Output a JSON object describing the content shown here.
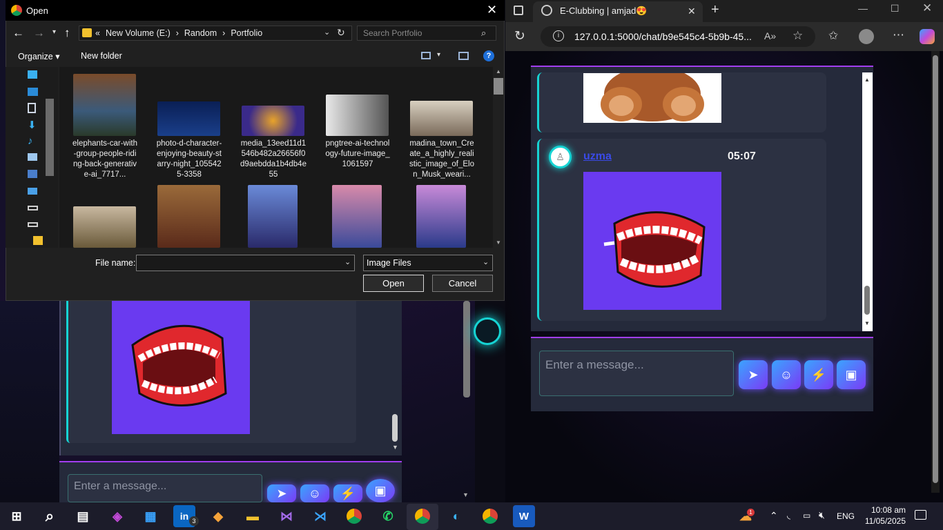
{
  "dialog": {
    "title": "Open",
    "breadcrumb": [
      "«",
      "New Volume (E:)",
      "Random",
      "Portfolio"
    ],
    "search_placeholder": "Search Portfolio",
    "organize_label": "Organize",
    "new_folder_label": "New folder",
    "file_name_label": "File name:",
    "file_name_value": "",
    "file_type": "Image Files",
    "open_label": "Open",
    "cancel_label": "Cancel",
    "files": [
      {
        "name": "elephants-car-with-group-people-riding-back-generative-ai_7717..."
      },
      {
        "name": "photo-d-character-enjoying-beauty-starry-night_1055425-3358"
      },
      {
        "name": "media_13eed11d1546b482a26656f0d9aebdda1b4db4e55"
      },
      {
        "name": "pngtree-ai-technology-future-image_1061597"
      },
      {
        "name": "madina_town_Create_a_highly_realistic_image_of_Elon_Musk_weari..."
      }
    ]
  },
  "left_chat": {
    "input_placeholder": "Enter a message..."
  },
  "edge": {
    "tab_title": "E-Clubbing | amjad😍",
    "url": "127.0.0.1:5000/chat/b9e545c4-5b9b-45..."
  },
  "chat": {
    "message_user": "uzma",
    "message_time": "05:07",
    "input_placeholder": "Enter a message..."
  },
  "taskbar": {
    "language": "ENG",
    "time": "10:08 am",
    "date": "11/05/2025",
    "linkedin_badge": "3",
    "weather_badge": "1"
  },
  "colors": {
    "accent_cyan": "#16d4d4",
    "accent_purple": "#a23ef0",
    "image_bg": "#6a3af0",
    "panel": "#252a3b"
  }
}
